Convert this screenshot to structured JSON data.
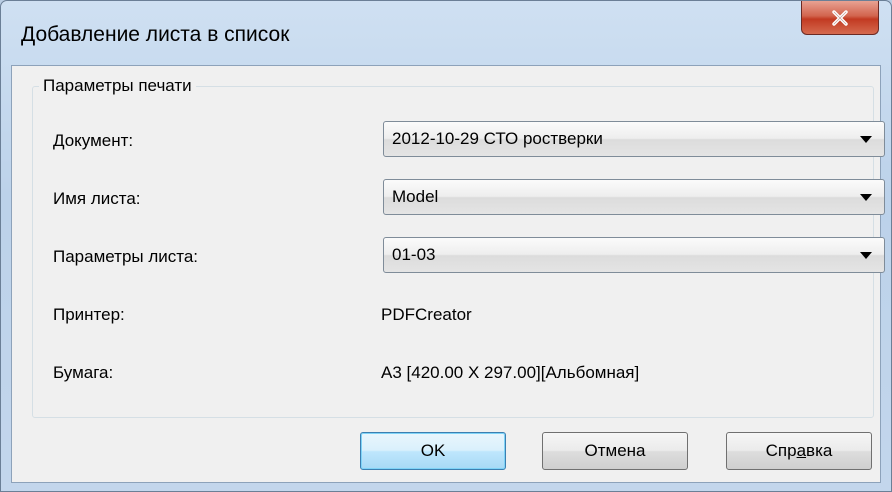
{
  "window": {
    "title": "Добавление листа в список"
  },
  "group": {
    "legend": "Параметры печати",
    "document": {
      "label": "Документ:",
      "value": "2012-10-29 СТО ростверки"
    },
    "sheet_name": {
      "label": "Имя листа:",
      "value": "Model"
    },
    "sheet_params": {
      "label": "Параметры листа:",
      "value": "01-03"
    },
    "printer": {
      "label": "Принтер:",
      "value": "PDFCreator"
    },
    "paper": {
      "label": "Бумага:",
      "value": "A3 [420.00 X 297.00][Альбомная]"
    }
  },
  "buttons": {
    "ok": "OK",
    "cancel": "Отмена",
    "help_prefix": "Спр",
    "help_mnemonic": "а",
    "help_suffix": "вка"
  },
  "icons": {
    "close": "close-icon",
    "dropdown": "chevron-down-icon"
  },
  "colors": {
    "close_button": "#c23a22",
    "default_button_border": "#3c7fb1",
    "window_frame": "#bcd2ea"
  }
}
